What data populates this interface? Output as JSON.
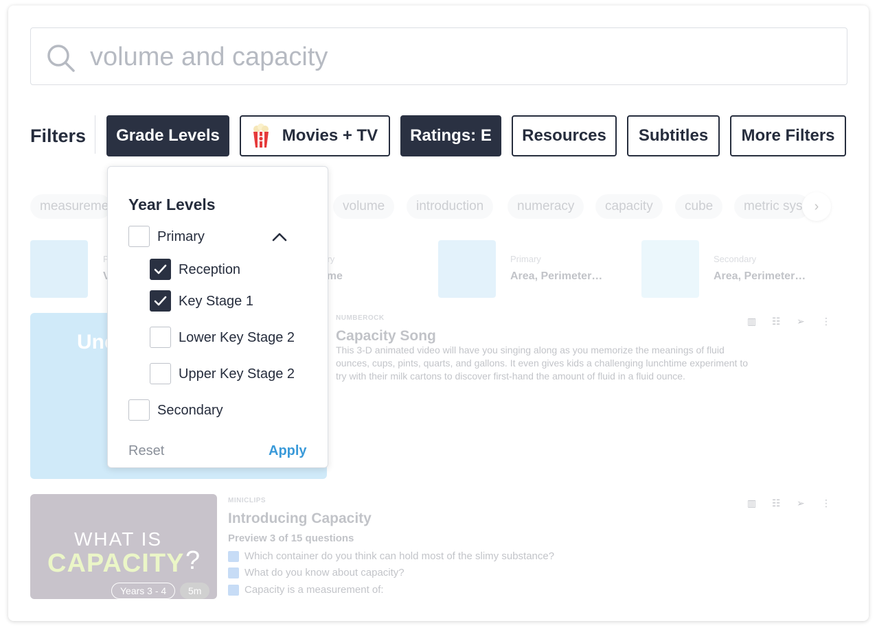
{
  "search": {
    "value": "volume and capacity"
  },
  "filters": {
    "label": "Filters",
    "buttons": {
      "grade_levels": "Grade Levels",
      "movies_tv": "Movies + TV",
      "ratings": "Ratings: E",
      "resources": "Resources",
      "subtitles": "Subtitles",
      "more_filters": "More Filters"
    }
  },
  "tags": [
    "measureme",
    "volume",
    "introduction",
    "numeracy",
    "capacity",
    "cube",
    "metric sys"
  ],
  "mini_cards": [
    {
      "level": "P",
      "title": "V"
    },
    {
      "level": "nary",
      "title": "ume"
    },
    {
      "level": "Primary",
      "title": "Area, Perimeter…"
    },
    {
      "level": "Secondary",
      "title": "Area, Perimeter…"
    }
  ],
  "resource1": {
    "thumb_text": "Unc",
    "source": "NUMBEROCK",
    "title": "Capacity Song",
    "description": "This 3-D animated video will have you singing along as you memorize the meanings of fluid ounces, cups, pints, quarts, and gallons. It even gives kids a challenging lunchtime experiment to try with their milk cartons to discover first-hand the amount of fluid in a fluid ounce."
  },
  "resource2": {
    "thumb_what": "WHAT IS",
    "thumb_cap": "CAPACITY",
    "thumb_q": "?",
    "years": "Years 3 - 4",
    "duration": "5m",
    "source": "MINICLIPS",
    "title": "Introducing Capacity",
    "preview": "Preview 3 of 15 questions",
    "questions": [
      "Which container do you think can hold most of the slimy substance?",
      "What do you know about capacity?",
      "Capacity is a measurement of:"
    ]
  },
  "dropdown": {
    "title": "Year Levels",
    "primary": "Primary",
    "reception": "Reception",
    "ks1": "Key Stage 1",
    "lks2": "Lower Key Stage 2",
    "uks2": "Upper Key Stage 2",
    "secondary": "Secondary",
    "reset": "Reset",
    "apply": "Apply"
  },
  "colors": {
    "dark_button": "#2a3142",
    "apply_link": "#3a9ad9",
    "checkbox_checked": "#2a3142"
  }
}
